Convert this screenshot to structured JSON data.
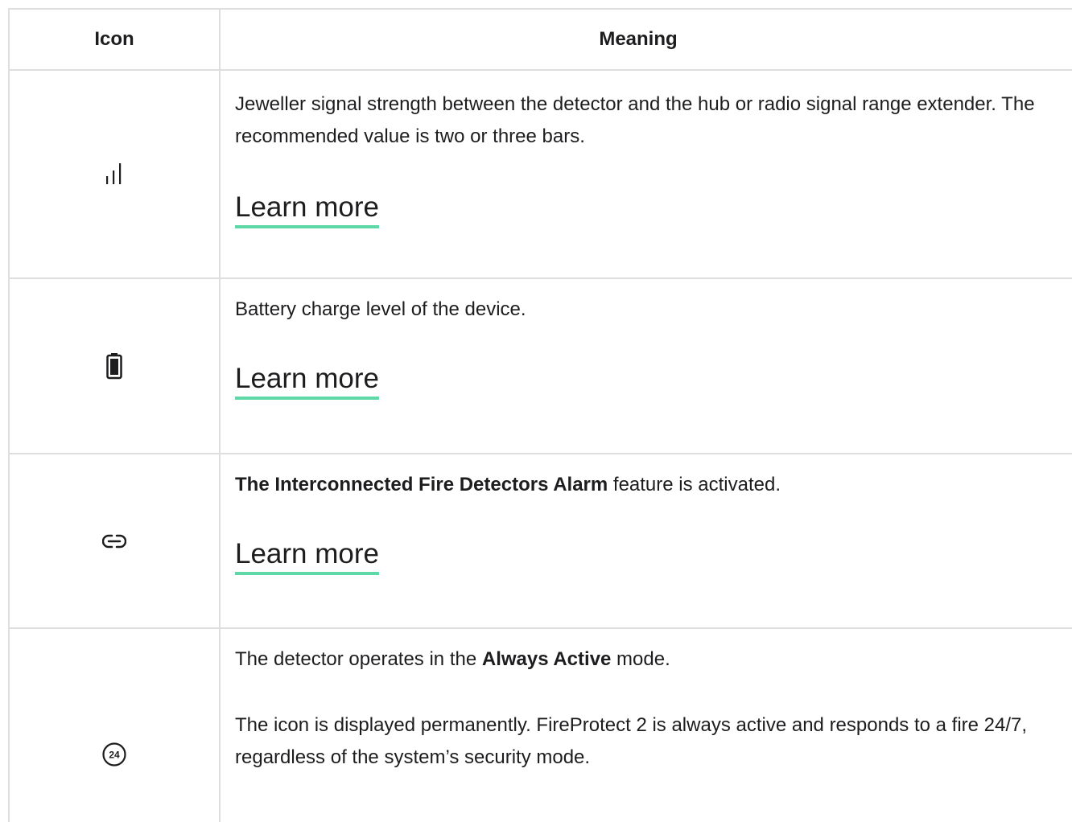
{
  "table": {
    "headers": {
      "icon": "Icon",
      "meaning": "Meaning"
    },
    "rows": [
      {
        "icon": "signal-strength-icon",
        "text": "Jeweller signal strength between the detector and the hub or radio signal range extender. The recommended value is two or three bars.",
        "link": "Learn more"
      },
      {
        "icon": "battery-icon",
        "text": "Battery charge level of the device.",
        "link": "Learn more"
      },
      {
        "icon": "link-icon",
        "text_bold": "The Interconnected Fire Detectors Alarm",
        "text_rest": " feature is activated.",
        "link": "Learn more"
      },
      {
        "icon": "always-active-24-icon",
        "icon_label": "24",
        "text_pre": "The detector operates in the ",
        "text_bold": "Always Active",
        "text_post": " mode.",
        "text2": "The icon is displayed permanently. FireProtect 2 is always active and responds to a fire 24/7, regardless of the system’s security mode."
      }
    ]
  },
  "colors": {
    "link_underline": "#5fd8a8",
    "border": "#dedede",
    "text": "#1d1d1f"
  }
}
